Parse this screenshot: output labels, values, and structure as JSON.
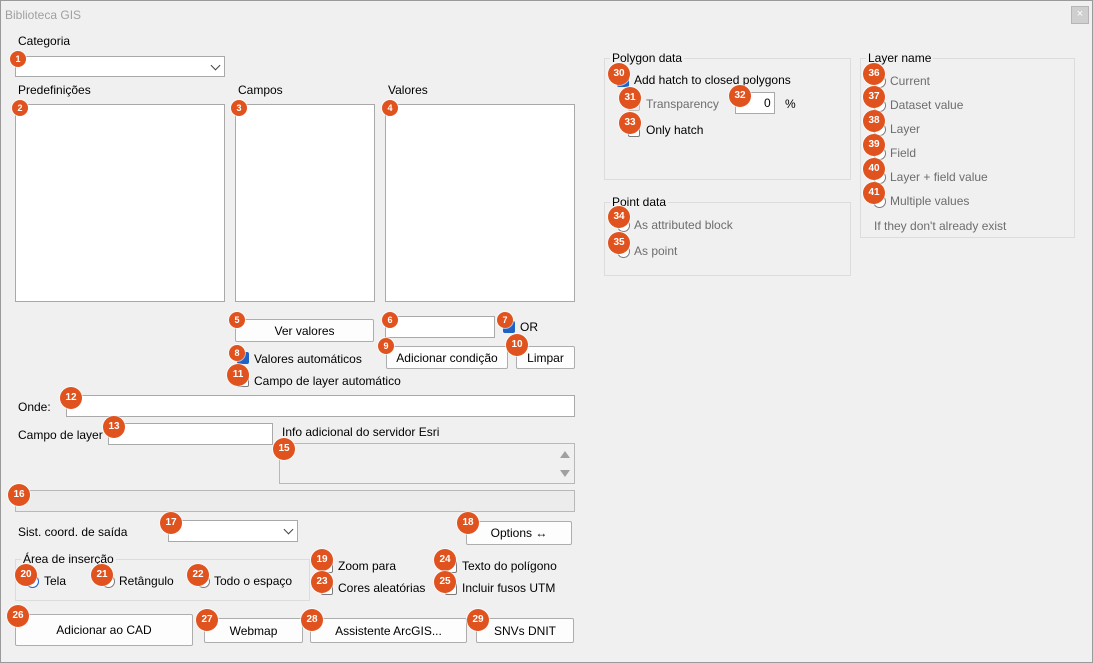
{
  "window": {
    "title": "Biblioteca GIS",
    "close_glyph": "×"
  },
  "categoria": {
    "label": "Categoria",
    "value": ""
  },
  "lists": {
    "predefinicoes": "Predefinições",
    "campos": "Campos",
    "valores": "Valores"
  },
  "buttons": {
    "ver_valores": "Ver valores",
    "adicionar_condicao": "Adicionar condição",
    "limpar": "Limpar",
    "options": "Options ↔",
    "adicionar_cad": "Adicionar ao CAD",
    "webmap": "Webmap",
    "assistente": "Assistente ArcGIS...",
    "snvs": "SNVs DNIT"
  },
  "condition": {
    "value": "",
    "or_label": "OR"
  },
  "checks": {
    "valores_automaticos": "Valores automáticos",
    "campo_layer_automatico": "Campo de layer automático",
    "zoom_para": "Zoom para",
    "cores_aleatorias": "Cores aleatórias",
    "texto_poligono": "Texto do polígono",
    "incluir_fusos": "Incluir fusos UTM"
  },
  "onde": {
    "label": "Onde:",
    "value": ""
  },
  "campo_layer": {
    "label": "Campo de layer",
    "value": ""
  },
  "info_esri": {
    "label": "Info adicional do servidor Esri"
  },
  "sist_coord": {
    "label": "Sist. coord. de saída",
    "value": ""
  },
  "area_insercao": {
    "label": "Área de inserção",
    "tela": "Tela",
    "retangulo": "Retângulo",
    "todo_espaco": "Todo o espaço"
  },
  "polygon_data": {
    "title": "Polygon data",
    "add_hatch": "Add hatch to closed polygons",
    "transparency": "Transparency",
    "transparency_value": "0",
    "percent": "%",
    "only_hatch": "Only hatch"
  },
  "point_data": {
    "title": "Point data",
    "as_block": "As attributed block",
    "as_point": "As point"
  },
  "layer_name": {
    "title": "Layer name",
    "current": "Current",
    "dataset_value": "Dataset value",
    "layer": "Layer",
    "field": "Field",
    "layer_field_value": "Layer + field value",
    "multiple_values": "Multiple values",
    "note": "If they don't already exist"
  },
  "badges": [
    "1",
    "2",
    "3",
    "4",
    "5",
    "6",
    "7",
    "8",
    "9",
    "10",
    "11",
    "12",
    "13",
    "15",
    "16",
    "17",
    "18",
    "19",
    "20",
    "21",
    "22",
    "23",
    "24",
    "25",
    "26",
    "27",
    "28",
    "29",
    "30",
    "31",
    "32",
    "33",
    "34",
    "35",
    "36",
    "37",
    "38",
    "39",
    "40",
    "41"
  ],
  "colors": {
    "badge": "#e0531f",
    "accent": "#1f62c6",
    "background": "#f0f0f0"
  }
}
